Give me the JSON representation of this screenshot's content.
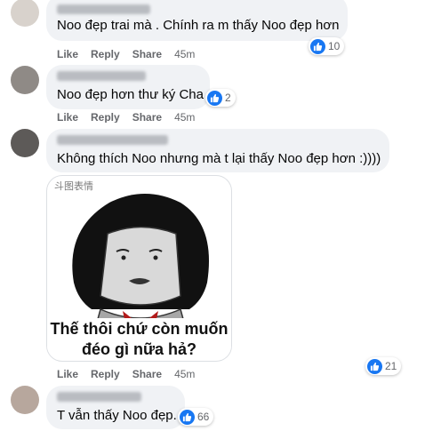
{
  "comments": [
    {
      "text": "Noo đẹp trai mà . Chính ra m thấy Noo đẹp hơn",
      "reactions": "10"
    },
    {
      "text": "Noo đẹp hơn thư ký Cha",
      "reactions": "2"
    },
    {
      "text": "Không thích Noo nhưng mà t lại thấy Noo đẹp hơn :))))",
      "reactions": "21",
      "meme": {
        "source": "斗图表情",
        "caption_line1": "Thế thôi chứ còn muốn",
        "caption_line2": "đéo gì nữa hả?"
      }
    },
    {
      "text": "T vẫn thấy Noo đẹp.",
      "reactions": "66"
    }
  ],
  "actions": {
    "like": "Like",
    "reply": "Reply",
    "share": "Share",
    "time": "45m"
  },
  "colors": {
    "like_blue": "#1877f2",
    "bubble_bg": "#f0f2f5",
    "action_gray": "#65676b"
  }
}
